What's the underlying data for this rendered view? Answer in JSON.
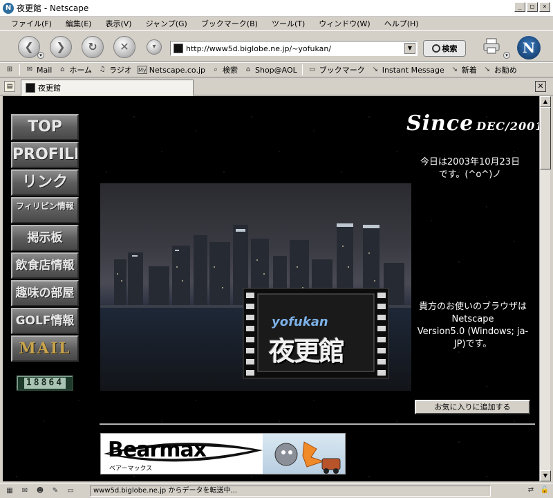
{
  "window": {
    "title": "夜更館 - Netscape",
    "buttons": {
      "minimize": "_",
      "maximize": "□",
      "close": "×"
    }
  },
  "menu": [
    "ファイル(F)",
    "編集(E)",
    "表示(V)",
    "ジャンプ(G)",
    "ブックマーク(B)",
    "ツール(T)",
    "ウィンドウ(W)",
    "ヘルプ(H)"
  ],
  "nav": {
    "url": "http://www5d.biglobe.ne.jp/~yofukan/",
    "search_label": "検索"
  },
  "personal_toolbar": [
    {
      "icon": "mail-icon",
      "label": "Mail"
    },
    {
      "icon": "home-icon",
      "label": "ホーム"
    },
    {
      "icon": "radio-icon",
      "label": "ラジオ"
    },
    {
      "icon": "netscape-icon",
      "label": "Netscape.co.jp"
    },
    {
      "icon": "search-icon",
      "label": "検索"
    },
    {
      "icon": "shop-icon",
      "label": "Shop@AOL"
    },
    {
      "icon": "folder-icon",
      "label": "ブックマーク"
    },
    {
      "icon": "link-icon",
      "label": "Instant Message"
    },
    {
      "icon": "link-icon",
      "label": "新着"
    },
    {
      "icon": "link-icon",
      "label": "お勧め"
    }
  ],
  "tab": {
    "title": "夜更館"
  },
  "sidebar": {
    "items": [
      "TOP",
      "PROFILE",
      "リンク",
      "フィリピン情報",
      "掲示板",
      "飲食店情報",
      "趣味の部屋",
      "GOLF情報",
      "MAIL"
    ],
    "counter": "18864"
  },
  "header": {
    "since": "Since",
    "since_date": "DEC/2001",
    "today_line1": "今日は2003年10月23日",
    "today_line2": "です。(^o^)ノ"
  },
  "hero": {
    "logo_en": "yofukan",
    "logo_jp": "夜更館"
  },
  "browser_info": {
    "line1": "貴方のお使いのブラウザは",
    "line2": "Netscape",
    "line3": "Version5.0 (Windows; ja-JP)です。"
  },
  "favorite_button": "お気に入りに追加する",
  "banner": {
    "brand": "Bearmax",
    "brand_kana": "ベアーマックス"
  },
  "status": {
    "text": "www5d.biglobe.ne.jp からデータを転送中..."
  }
}
